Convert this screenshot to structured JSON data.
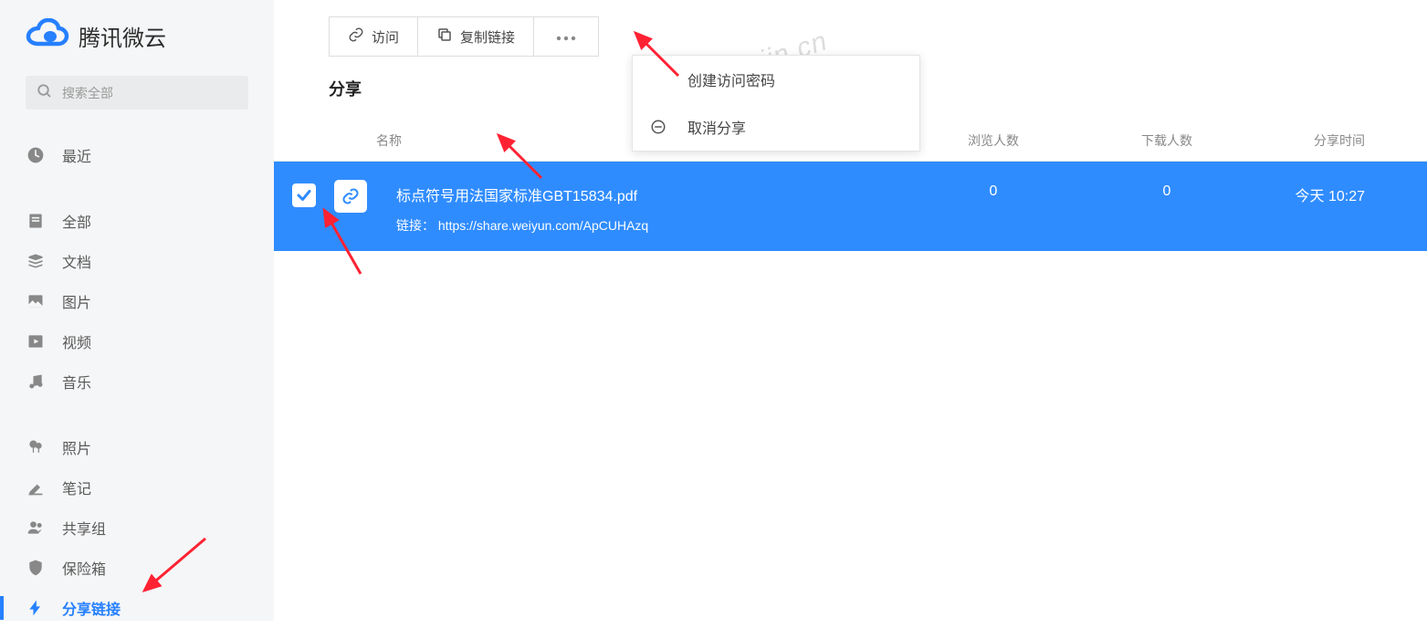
{
  "app_name": "腾讯微云",
  "search": {
    "placeholder": "搜索全部"
  },
  "sidebar": {
    "recent": "最近",
    "all": "全部",
    "documents": "文档",
    "images": "图片",
    "videos": "视频",
    "music": "音乐",
    "photos": "照片",
    "notes": "笔记",
    "groups": "共享组",
    "safe": "保险箱",
    "share_links": "分享链接"
  },
  "toolbar": {
    "visit": "访问",
    "copy_link": "复制链接"
  },
  "dropdown": {
    "create_password": "创建访问密码",
    "cancel_share": "取消分享"
  },
  "section_title": "分享",
  "columns": {
    "name": "名称",
    "views": "浏览人数",
    "downloads": "下载人数",
    "time": "分享时间"
  },
  "row": {
    "file_name": "标点符号用法国家标准GBT15834.pdf",
    "link_label": "链接：",
    "link_url": "https://share.weiyun.com/ApCUHAzq",
    "views": "0",
    "downloads": "0",
    "time": "今天 10:27"
  },
  "watermark": "www.yigujin.cn"
}
